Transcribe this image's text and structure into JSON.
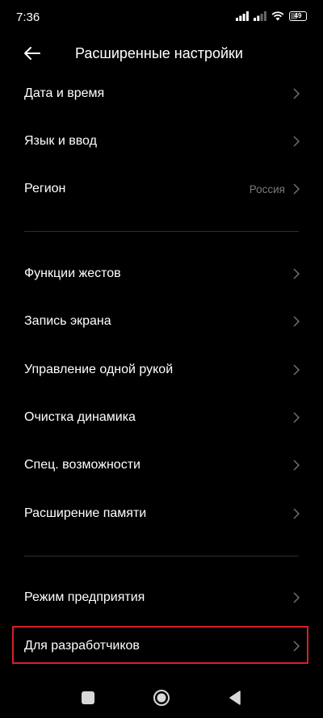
{
  "status_bar": {
    "time": "7:36",
    "battery": "49",
    "icons": [
      "signal-icon",
      "signal-icon",
      "wifi-icon",
      "battery-icon"
    ]
  },
  "header": {
    "title": "Расширенные настройки",
    "back_icon": "back-arrow-icon"
  },
  "sections": [
    {
      "items": [
        {
          "label": "Дата и время",
          "value": ""
        },
        {
          "label": "Язык и ввод",
          "value": ""
        },
        {
          "label": "Регион",
          "value": "Россия"
        }
      ]
    },
    {
      "items": [
        {
          "label": "Функции жестов",
          "value": ""
        },
        {
          "label": "Запись экрана",
          "value": ""
        },
        {
          "label": "Управление одной рукой",
          "value": ""
        },
        {
          "label": "Очистка динамика",
          "value": ""
        },
        {
          "label": "Спец. возможности",
          "value": ""
        },
        {
          "label": "Расширение памяти",
          "value": ""
        }
      ]
    },
    {
      "items": [
        {
          "label": "Режим предприятия",
          "value": ""
        },
        {
          "label": "Для разработчиков",
          "value": ""
        }
      ]
    }
  ],
  "highlight_color": "#d6202a",
  "nav_bar": {
    "icons": [
      "square-icon",
      "home-circle-icon",
      "back-triangle-icon"
    ]
  }
}
